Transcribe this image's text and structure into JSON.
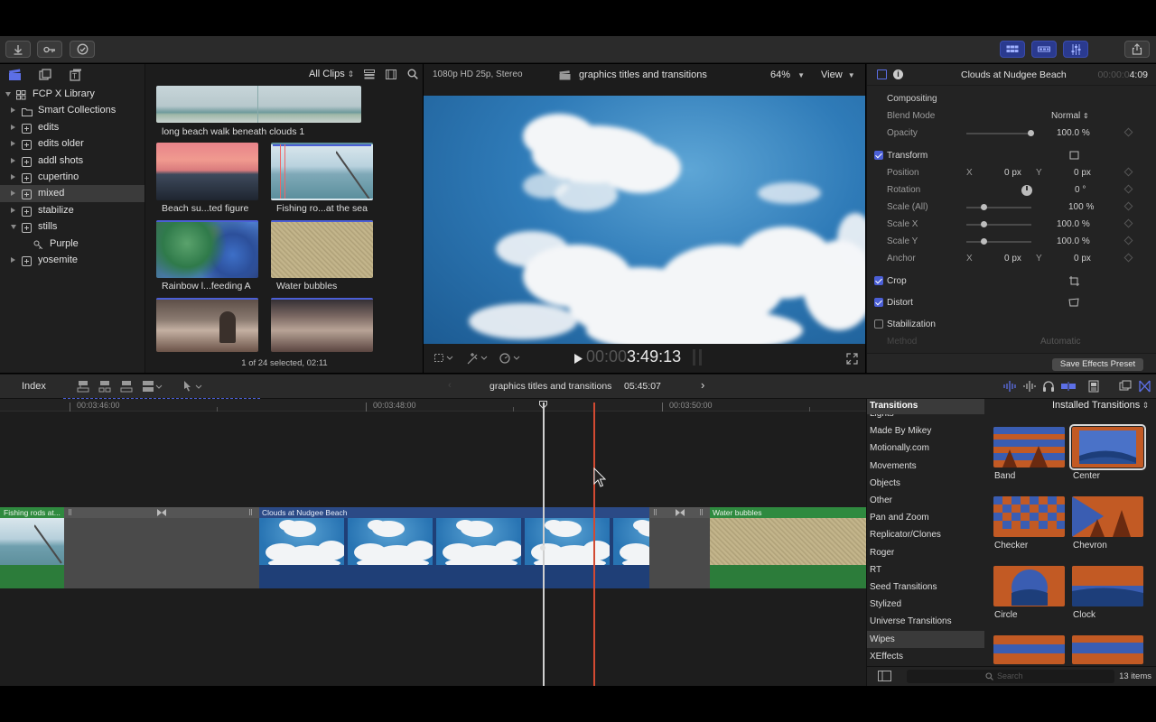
{
  "colors": {
    "accent": "#4b5fd6",
    "playhead": "#d24a32",
    "clip_blue": "#2b4a86",
    "clip_green": "#27823a"
  },
  "toolbar": {
    "import_icon": "download-arrow-icon",
    "keywords_icon": "key-icon",
    "background_tasks_icon": "checkmark-circle-icon",
    "share_icon": "share-icon"
  },
  "library": {
    "items": [
      {
        "label": "FCP X Library",
        "level": 0,
        "expand": "down",
        "icon": "library-icon"
      },
      {
        "label": "Smart Collections",
        "level": 1,
        "expand": "right",
        "icon": "folder-icon"
      },
      {
        "label": "edits",
        "level": 1,
        "expand": "right",
        "icon": "event-icon"
      },
      {
        "label": "edits older",
        "level": 1,
        "expand": "right",
        "icon": "event-icon"
      },
      {
        "label": "addl shots",
        "level": 1,
        "expand": "right",
        "icon": "event-icon"
      },
      {
        "label": "cupertino",
        "level": 1,
        "expand": "right",
        "icon": "event-icon"
      },
      {
        "label": "mixed",
        "level": 1,
        "expand": "right",
        "icon": "event-icon",
        "selected": true
      },
      {
        "label": "stabilize",
        "level": 1,
        "expand": "right",
        "icon": "event-icon"
      },
      {
        "label": "stills",
        "level": 1,
        "expand": "down",
        "icon": "event-icon"
      },
      {
        "label": "Purple",
        "level": 2,
        "expand": "none",
        "icon": "keyword-icon"
      },
      {
        "label": "yosemite",
        "level": 1,
        "expand": "right",
        "icon": "event-icon"
      }
    ]
  },
  "browser": {
    "filter": "All Clips",
    "clips": [
      {
        "label": "long beach walk beneath clouds 1"
      },
      {
        "label": "Beach su...ted figure"
      },
      {
        "label": "Fishing ro...at the sea"
      },
      {
        "label": "Rainbow l...feeding A"
      },
      {
        "label": "Water bubbles"
      }
    ],
    "status": "1 of 24 selected, 02:11"
  },
  "viewer": {
    "format": "1080p HD 25p, Stereo",
    "project": "graphics titles and transitions",
    "zoom": "64%",
    "view": "View",
    "timecode_dim": "00:00",
    "timecode": "3:49:13"
  },
  "inspector": {
    "clip_name": "Clouds at Nudgee Beach",
    "duration_dim": "00:00:0",
    "duration": "4:09",
    "compositing": "Compositing",
    "blend_mode_label": "Blend Mode",
    "blend_mode": "Normal",
    "opacity_label": "Opacity",
    "opacity": "100.0",
    "transform": "Transform",
    "position_label": "Position",
    "rotation_label": "Rotation",
    "rotation": "0",
    "scale_all_label": "Scale (All)",
    "scale_all": "100",
    "scale_x_label": "Scale X",
    "scale_x": "100.0",
    "scale_y_label": "Scale Y",
    "scale_y": "100.0",
    "anchor_label": "Anchor",
    "x": "X",
    "y": "Y",
    "zero": "0",
    "px": "px",
    "pct": "%",
    "deg": "°",
    "crop": "Crop",
    "distort": "Distort",
    "stabilization": "Stabilization",
    "method_label": "Method",
    "method": "Automatic",
    "save_preset": "Save Effects Preset"
  },
  "timeline": {
    "index": "Index",
    "project": "graphics titles and transitions",
    "duration": "05:45:07",
    "ruler": [
      "00:03:46:00",
      "00:03:48:00",
      "00:03:50:00"
    ],
    "clips": [
      {
        "label": "Fishing rods at..."
      },
      {
        "label": "Clouds at Nudgee Beach"
      },
      {
        "label": "Water bubbles"
      }
    ]
  },
  "transitions": {
    "title": "Transitions",
    "filter": "Installed Transitions",
    "categories": [
      "Lights",
      "Made By Mikey",
      "Motionally.com",
      "Movements",
      "Objects",
      "Other",
      "Pan and Zoom",
      "Replicator/Clones",
      "Roger",
      "RT",
      "Seed Transitions",
      "Stylized",
      "Universe Transitions",
      "Wipes",
      "XEffects"
    ],
    "selected_category": "Wipes",
    "items": [
      "Band",
      "Center",
      "Checker",
      "Chevron",
      "Circle",
      "Clock"
    ],
    "search_placeholder": "Search",
    "count": "13 items"
  }
}
